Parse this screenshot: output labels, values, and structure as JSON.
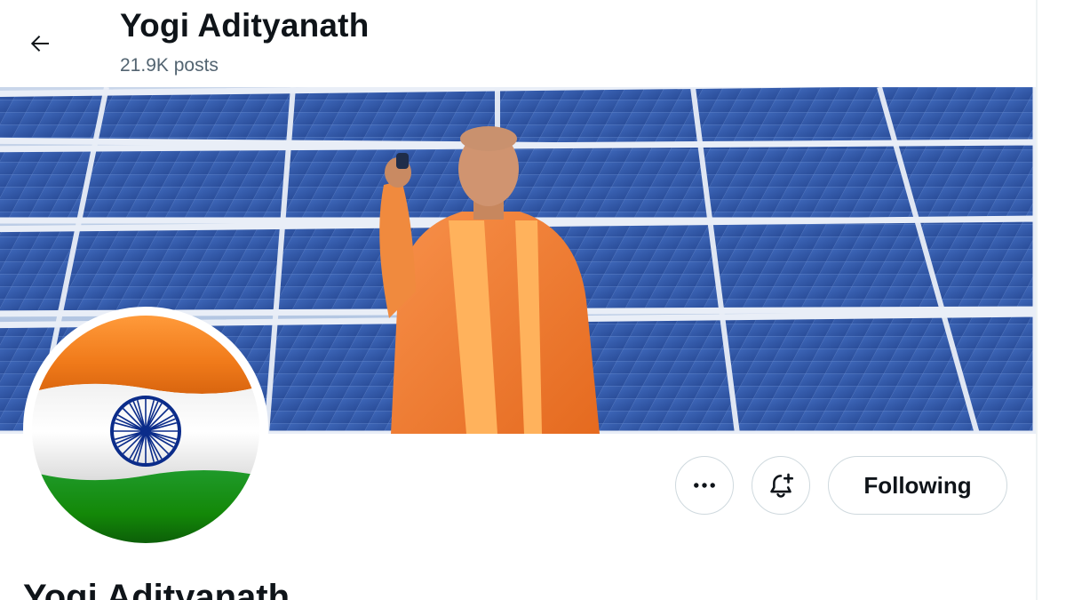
{
  "header": {
    "title": "Yogi Adityanath",
    "posts_count": "21.9K posts"
  },
  "icons": {
    "back": "arrow-left-icon",
    "more": "more-horizontal-icon",
    "notify": "bell-plus-icon"
  },
  "profile": {
    "display_name": "Yogi Adityanath",
    "follow_label": "Following"
  },
  "colors": {
    "text_primary": "#0f1419",
    "text_secondary": "#536471",
    "border": "#cfd9de",
    "saffron": "#f07a2b",
    "flag_green": "#138808",
    "chakra_blue": "#0b2c8a"
  }
}
